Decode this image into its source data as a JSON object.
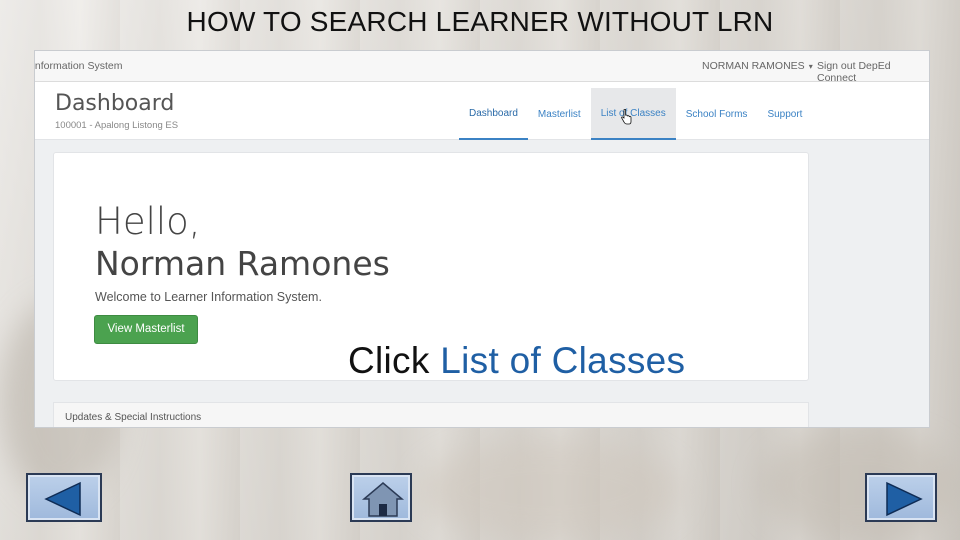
{
  "slide": {
    "title": "HOW TO SEARCH LEARNER WITHOUT LRN",
    "callout_prefix": "Click ",
    "callout_highlight": "List of Classes"
  },
  "app": {
    "brand": "Information System",
    "user_name": "NORMAN RAMONES",
    "signout": "Sign out DepEd Connect"
  },
  "header": {
    "page_title": "Dashboard",
    "school": "100001 - Apalong Listong ES"
  },
  "nav": {
    "items": [
      "Dashboard",
      "Masterlist",
      "List of Classes",
      "School Forms",
      "Support"
    ],
    "active": "Dashboard",
    "hovered": "List of Classes"
  },
  "greeting": {
    "line1": "Hello,",
    "line2": "Norman Ramones",
    "welcome": "Welcome to Learner Information System.",
    "button": "View Masterlist"
  },
  "updates": {
    "title": "Updates & Special Instructions"
  },
  "colors": {
    "accent": "#3b82c4",
    "button_green": "#4ba24f",
    "callout_highlight": "#1f5fa4"
  },
  "icons": {
    "prev": "left-triangle-icon",
    "home": "home-icon",
    "next": "right-triangle-icon",
    "cursor": "hand-pointer-icon"
  }
}
